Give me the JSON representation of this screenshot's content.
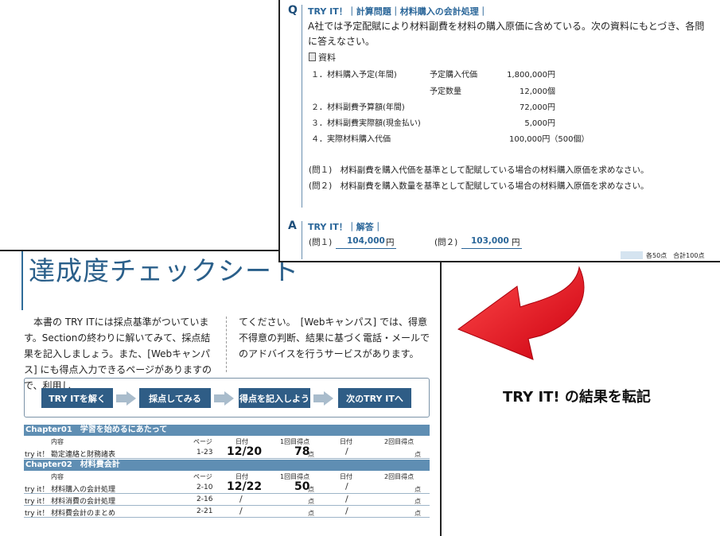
{
  "checksheet": {
    "title": "達成度チェックシート",
    "intro_left": "　本書の TRY ITには採点基準がついています。Sectionの終わりに解いてみて、採点結果を記入しましょう。また、[Webキャンパス] にも得点入力できるページがありますので、利用し",
    "intro_right": "てください。　[Webキャンパス] では、得意不得意の判断、結果に基づく電話・メールでのアドバイスを行うサービスがあります。",
    "steps": [
      "TRY ITを解く",
      "採点してみる",
      "得点を記入しよう",
      "次のTRY ITへ"
    ],
    "columns": {
      "content": "内容",
      "page": "ページ",
      "date": "日付",
      "score1": "1回目得点",
      "date2": "日付",
      "score2": "2回目得点"
    },
    "point_unit": "点",
    "chapters": [
      {
        "title": "Chapter01　学習を始めるにあたって",
        "rows": [
          {
            "tag": "try it！",
            "name": "勘定連絡と財務諸表",
            "page": "1-23",
            "date": "12/20",
            "score": "78",
            "date2": "/"
          }
        ]
      },
      {
        "title": "Chapter02　材料費会計",
        "rows": [
          {
            "tag": "try it！",
            "name": "材料購入の会計処理",
            "page": "2-10",
            "date": "12/22",
            "score": "50",
            "date2": "/"
          },
          {
            "tag": "try it！",
            "name": "材料消費の会計処理",
            "page": "2-16",
            "date": "/",
            "score": "",
            "date2": "/"
          },
          {
            "tag": "try it！",
            "name": "材料費会計のまとめ",
            "page": "2-21",
            "date": "/",
            "score": "",
            "date2": "/"
          }
        ]
      }
    ]
  },
  "tryit": {
    "q_mark": "Q",
    "a_mark": "A",
    "q_header": "TRY IT！｜計算問題｜材料購入の会計処理｜",
    "question": "A社では予定配賦により材料副費を材料の購入原価に含めている。次の資料にもとづき、各問に答えなさい。",
    "materials_label": "資料",
    "materials": [
      {
        "label": "１．材料購入予定(年間)",
        "sub": "予定購入代価",
        "value": "1,800,000円"
      },
      {
        "label": "",
        "sub": "予定数量",
        "value": "12,000個"
      },
      {
        "label": "２．材料副費予算額(年間)",
        "sub": "",
        "value": "72,000円"
      },
      {
        "label": "３．材料副費実際額(現金払い)",
        "sub": "",
        "value": "5,000円"
      },
      {
        "label": "４．実際材料購入代価",
        "sub": "",
        "value": "100,000円（500個）"
      }
    ],
    "q1": "(問１)　材料副費を購入代価を基準として配賦している場合の材料購入原価を求めなさい。",
    "q2": "(問２)　材料副費を購入数量を基準として配賦している場合の材料購入原価を求めなさい。",
    "a_header": "TRY IT！｜解答｜",
    "answers": [
      {
        "label": "(問１)",
        "value": "104,000",
        "unit": "円"
      },
      {
        "label": "(問２)",
        "value": "103,000",
        "unit": "円"
      }
    ],
    "score_note": "各50点　合計100点"
  },
  "caption": "TRY IT! の結果を転記",
  "colors": {
    "accent": "#2a6699",
    "chapter_bar": "#5f8eb3",
    "step_btn": "#2f5d86",
    "arrow": "#e60012"
  }
}
